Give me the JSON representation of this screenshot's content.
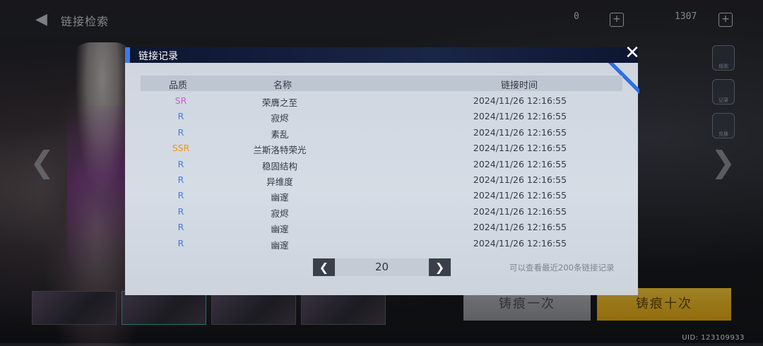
{
  "background": {
    "page_title": "链接检索",
    "currency_1": "0",
    "currency_2": "1307",
    "side_nav": [
      "规则",
      "记录",
      "兑换"
    ],
    "pull_once_label": "铸痕一次",
    "pull_ten_label": "铸痕十次",
    "uid_text": "UID: 123109933"
  },
  "modal": {
    "title": "链接记录",
    "close_glyph": "✕",
    "columns": {
      "quality": "品质",
      "name": "名称",
      "time": "链接时间"
    },
    "rows": [
      {
        "quality": "SR",
        "name": "荣膺之至",
        "time": "2024/11/26 12:16:55"
      },
      {
        "quality": "R",
        "name": "寂烬",
        "time": "2024/11/26 12:16:55"
      },
      {
        "quality": "R",
        "name": "素乱",
        "time": "2024/11/26 12:16:55"
      },
      {
        "quality": "SSR",
        "name": "兰斯洛特荣光",
        "time": "2024/11/26 12:16:55"
      },
      {
        "quality": "R",
        "name": "稳固结构",
        "time": "2024/11/26 12:16:55"
      },
      {
        "quality": "R",
        "name": "异维度",
        "time": "2024/11/26 12:16:55"
      },
      {
        "quality": "R",
        "name": "幽邃",
        "time": "2024/11/26 12:16:55"
      },
      {
        "quality": "R",
        "name": "寂烬",
        "time": "2024/11/26 12:16:55"
      },
      {
        "quality": "R",
        "name": "幽邃",
        "time": "2024/11/26 12:16:55"
      },
      {
        "quality": "R",
        "name": "幽邃",
        "time": "2024/11/26 12:16:55"
      }
    ],
    "pager": {
      "prev_glyph": "❮",
      "next_glyph": "❯",
      "page_value": "20"
    },
    "hint": "可以查看最近200条链接记录"
  },
  "colors": {
    "SR": "#d15ad6",
    "R": "#3f7fe0",
    "SSR": "#f0941e",
    "accent": "#3e79e8"
  }
}
